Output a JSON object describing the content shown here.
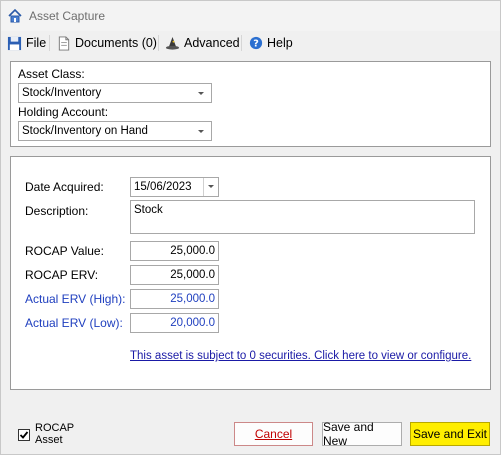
{
  "window": {
    "title": "Asset Capture"
  },
  "menu": {
    "file": "File",
    "documents": "Documents (0)",
    "advanced": "Advanced",
    "help": "Help"
  },
  "asset_class": {
    "label": "Asset Class:",
    "value": "Stock/Inventory"
  },
  "holding_account": {
    "label": "Holding Account:",
    "value": "Stock/Inventory on Hand"
  },
  "date_acquired": {
    "label": "Date Acquired:",
    "value": "15/06/2023"
  },
  "description": {
    "label": "Description:",
    "value": "Stock"
  },
  "rocap_value": {
    "label": "ROCAP Value:",
    "value": "25,000.0"
  },
  "rocap_erv": {
    "label": "ROCAP ERV:",
    "value": "25,000.0"
  },
  "actual_erv_high": {
    "label": "Actual ERV (High):",
    "value": "25,000.0"
  },
  "actual_erv_low": {
    "label": "Actual ERV (Low):",
    "value": "20,000.0"
  },
  "securities_link": "This asset is subject to 0 securities.  Click here to view or configure.",
  "rocap_asset": {
    "label_line1": "ROCAP",
    "label_line2": "Asset",
    "checked": true
  },
  "buttons": {
    "cancel": "Cancel",
    "save_new": "Save and New",
    "save_exit": "Save and Exit"
  },
  "colors": {
    "link_blue": "#1f3fbf",
    "cancel_red": "#c00000",
    "primary_yellow": "#ffee00"
  }
}
